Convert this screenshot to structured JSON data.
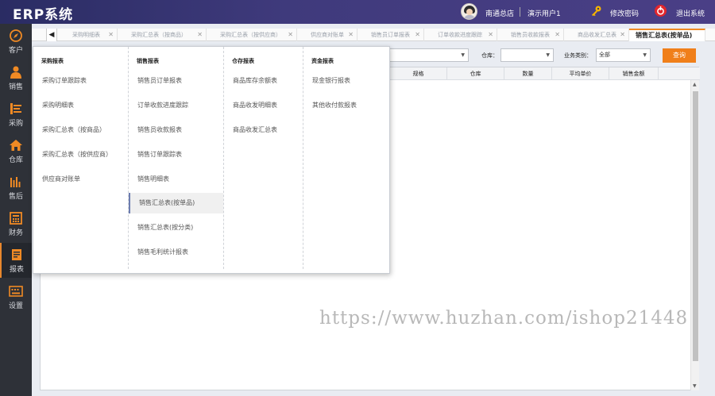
{
  "header": {
    "app_title": "ERP系统",
    "store": "南通总店",
    "user": "演示用户1",
    "change_password": "修改密码",
    "logout": "退出系统"
  },
  "sidebar": {
    "items": [
      {
        "label": "客户",
        "icon": "compass-icon"
      },
      {
        "label": "销售",
        "icon": "person-icon"
      },
      {
        "label": "采购",
        "icon": "list-chart-icon"
      },
      {
        "label": "仓库",
        "icon": "home-icon"
      },
      {
        "label": "售后",
        "icon": "people-icon"
      },
      {
        "label": "财务",
        "icon": "calculator-icon"
      },
      {
        "label": "报表",
        "icon": "report-icon"
      },
      {
        "label": "设置",
        "icon": "keyboard-icon"
      }
    ],
    "active": "报表"
  },
  "tabs": {
    "items": [
      "采购明细表",
      "采购汇总表（按商品）",
      "采购汇总表（按供应商）",
      "供应商对账单",
      "销售员订单报表",
      "订单收款进度跟踪",
      "销售员收款报表",
      "商品收发汇总表"
    ],
    "active": "销售汇总表(按单品)"
  },
  "filters": {
    "warehouse_label": "仓库：",
    "warehouse_value": "",
    "biz_type_label": "业务类别：",
    "biz_type_value": "全部",
    "query_button": "查询"
  },
  "table": {
    "columns": [
      "规格",
      "仓库",
      "数量",
      "平均单价",
      "销售金额"
    ]
  },
  "menu": {
    "columns": [
      {
        "title": "采购报表",
        "items": [
          "采购订单跟踪表",
          "采购明细表",
          "采购汇总表（按商品）",
          "采购汇总表（按供应商）",
          "供应商对账单"
        ]
      },
      {
        "title": "销售报表",
        "items": [
          "销售员订单报表",
          "订单收款进度跟踪",
          "销售员收款报表",
          "销售订单跟踪表",
          "销售明细表",
          "销售汇总表(按单品)",
          "销售汇总表(按分类)",
          "销售毛利统计报表"
        ],
        "active_index": 5
      },
      {
        "title": "仓存报表",
        "items": [
          "商品库存余额表",
          "商品收发明细表",
          "商品收发汇总表"
        ]
      },
      {
        "title": "资金报表",
        "items": [
          "现金银行报表",
          "其他收付款报表"
        ]
      }
    ]
  },
  "watermark": "https://www.huzhan.com/ishop21448",
  "colors": {
    "header_bg": "#2b2f66",
    "sidebar_bg": "#2e3138",
    "accent": "#f07f1a"
  }
}
